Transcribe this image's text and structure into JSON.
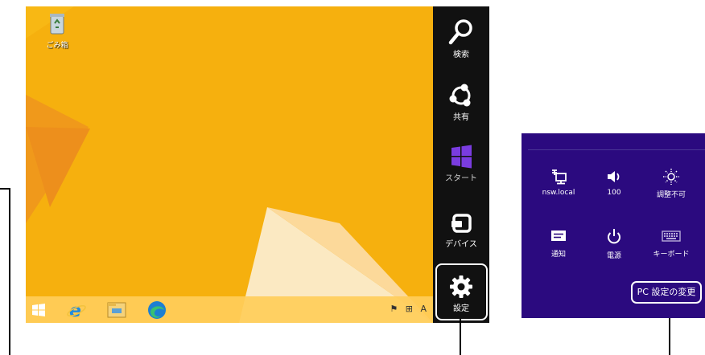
{
  "desktop": {
    "recycle_bin_label": "ごみ箱",
    "background_color": "#f6b00e"
  },
  "taskbar": {
    "icons": [
      "windows-start-icon",
      "internet-explorer-icon",
      "file-explorer-icon",
      "edge-icon"
    ],
    "tray": {
      "ime_mode": "A"
    }
  },
  "charms": [
    {
      "id": "search",
      "icon": "search-icon",
      "label": "検索"
    },
    {
      "id": "share",
      "icon": "share-icon",
      "label": "共有"
    },
    {
      "id": "start",
      "icon": "windows-logo-icon",
      "label": "スタート"
    },
    {
      "id": "devices",
      "icon": "devices-icon",
      "label": "デバイス"
    },
    {
      "id": "settings",
      "icon": "gear-icon",
      "label": "設定"
    }
  ],
  "settings_pane": {
    "background": "#2b0a7f",
    "quick_settings": [
      {
        "icon": "network-icon",
        "label": "nsw.local"
      },
      {
        "icon": "volume-icon",
        "label": "100"
      },
      {
        "icon": "brightness-icon",
        "label": "調整不可"
      },
      {
        "icon": "notifications-icon",
        "label": "通知"
      },
      {
        "icon": "power-icon",
        "label": "電源"
      },
      {
        "icon": "keyboard-icon",
        "label": "キーボード"
      }
    ],
    "pc_settings_link": "PC 設定の変更"
  }
}
